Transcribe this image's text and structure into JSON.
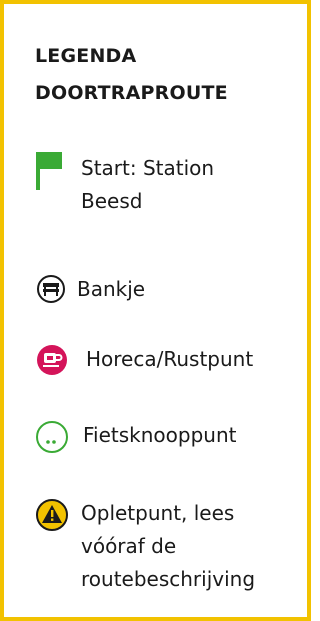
{
  "legend": {
    "title_line1": "LEGENDA",
    "title_line2": "DOORTRAPROUTE",
    "border_color": "#f2c200",
    "items": [
      {
        "icon": "green-flag-icon",
        "color": "#3aaa35",
        "lines": [
          "Start: Station",
          "Beesd"
        ]
      },
      {
        "icon": "bench-icon",
        "color": "#1a1a1a",
        "lines": [
          "Bankje"
        ]
      },
      {
        "icon": "cup-icon",
        "color": "#d4145a",
        "lines": [
          "Horeca/Rustpunt"
        ]
      },
      {
        "icon": "cycle-node-icon",
        "color": "#3aaa35",
        "icon_text": "..",
        "lines": [
          "Fietsknooppunt"
        ]
      },
      {
        "icon": "warning-icon",
        "color": "#f2c200",
        "icon_text": "!",
        "lines": [
          "Opletpunt, lees",
          "vóóraf de",
          "routebeschrijving"
        ]
      }
    ]
  }
}
